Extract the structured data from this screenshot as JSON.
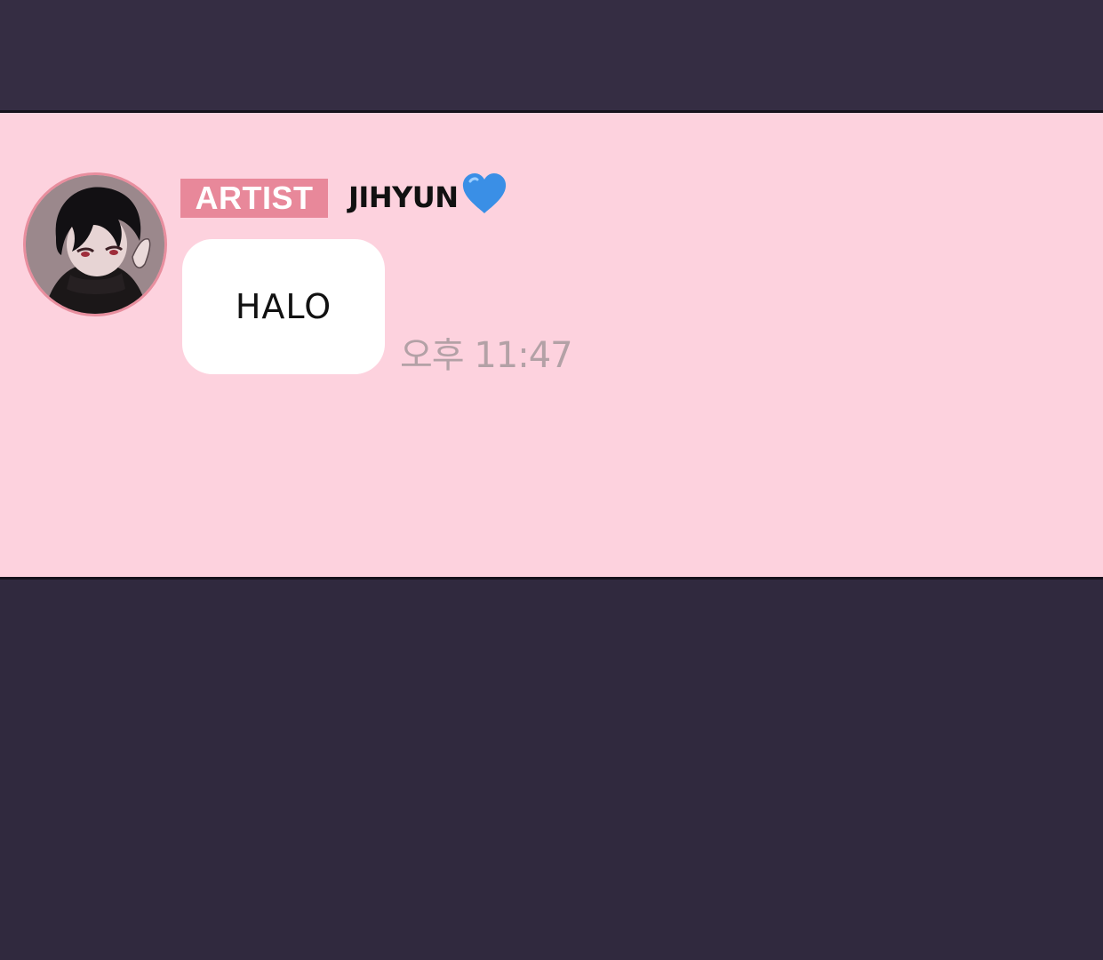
{
  "message": {
    "role_badge": "ARTIST",
    "sender_name": "JIHYUN",
    "sender_emoji": "blue-heart-icon",
    "text": "HALO",
    "time": "오후 11:47"
  },
  "colors": {
    "top_bar": "#352d43",
    "bottom_area": "#30293e",
    "chat_background": "#fdd2de",
    "badge": "#e8889a",
    "bubble": "#ffffff",
    "time_text": "#b3a1a6",
    "heart": "#3a8fe6"
  }
}
